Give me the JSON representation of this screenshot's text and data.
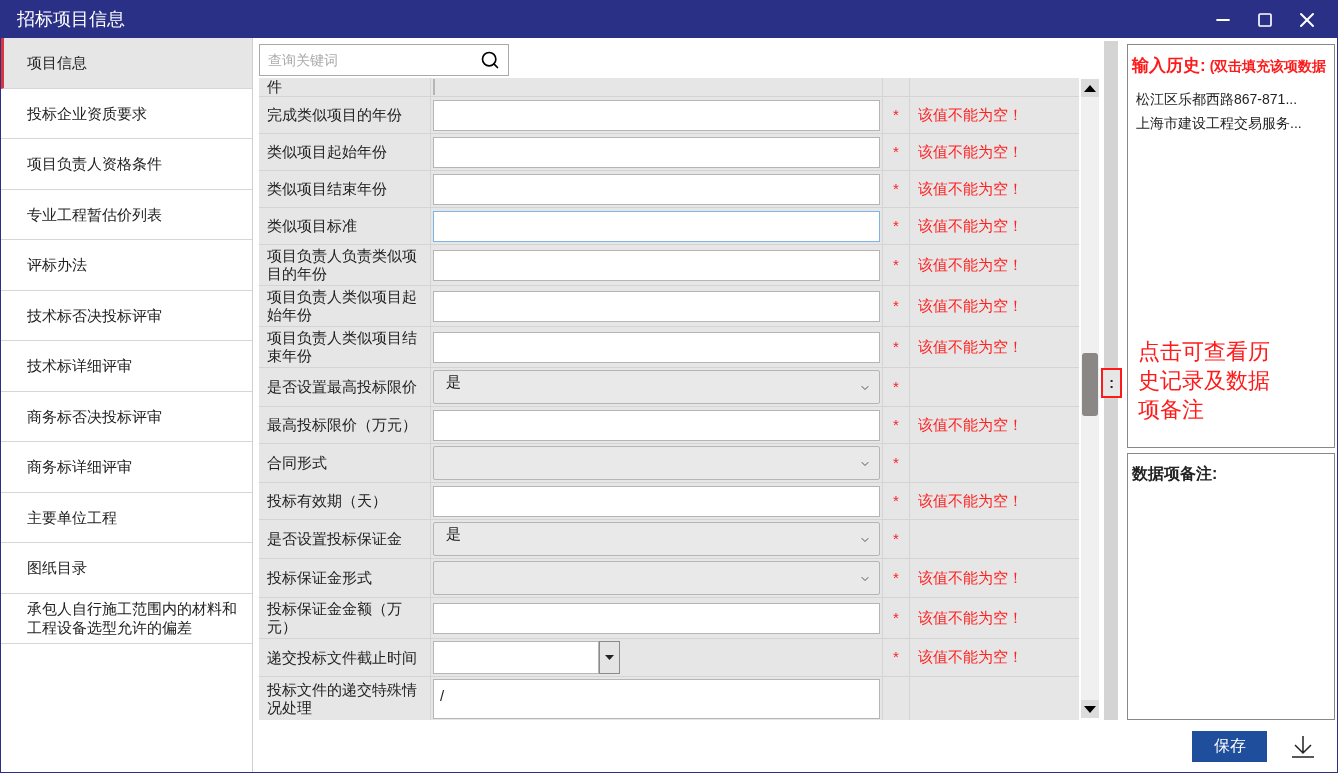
{
  "window": {
    "title": "招标项目信息"
  },
  "sidebar": {
    "items": [
      {
        "label": "项目信息",
        "selected": true
      },
      {
        "label": "投标企业资质要求",
        "selected": false
      },
      {
        "label": "项目负责人资格条件",
        "selected": false
      },
      {
        "label": "专业工程暂估价列表",
        "selected": false
      },
      {
        "label": "评标办法",
        "selected": false
      },
      {
        "label": "技术标否决投标评审",
        "selected": false
      },
      {
        "label": "技术标详细评审",
        "selected": false
      },
      {
        "label": "商务标否决投标评审",
        "selected": false
      },
      {
        "label": "商务标详细评审",
        "selected": false
      },
      {
        "label": "主要单位工程",
        "selected": false
      },
      {
        "label": "图纸目录",
        "selected": false
      },
      {
        "label": "承包人自行施工范围内的材料和工程设备选型允许的偏差",
        "selected": false
      }
    ]
  },
  "search": {
    "placeholder": "查询关键词"
  },
  "form": {
    "rows": [
      {
        "label": "件",
        "kind": "partial"
      },
      {
        "label": "完成类似项目的年份",
        "kind": "text",
        "error": "该值不能为空！",
        "star": "*"
      },
      {
        "label": "类似项目起始年份",
        "kind": "text",
        "error": "该值不能为空！",
        "star": "*"
      },
      {
        "label": "类似项目结束年份",
        "kind": "text",
        "error": "该值不能为空！",
        "star": "*"
      },
      {
        "label": "类似项目标准",
        "kind": "text",
        "focused": true,
        "error": "该值不能为空！",
        "star": "*"
      },
      {
        "label": "项目负责人负责类似项目的年份",
        "kind": "text",
        "error": "该值不能为空！",
        "star": "*"
      },
      {
        "label": "项目负责人类似项目起始年份",
        "kind": "text",
        "error": "该值不能为空！",
        "star": "*"
      },
      {
        "label": "项目负责人类似项目结束年份",
        "kind": "text",
        "error": "该值不能为空！",
        "star": "*"
      },
      {
        "label": "是否设置最高投标限价",
        "kind": "select",
        "value": "是",
        "star": "*"
      },
      {
        "label": "最高投标限价（万元）",
        "kind": "text",
        "error": "该值不能为空！",
        "star": "*"
      },
      {
        "label": "合同形式",
        "kind": "select",
        "star": "*"
      },
      {
        "label": "投标有效期（天）",
        "kind": "text",
        "error": "该值不能为空！",
        "star": "*"
      },
      {
        "label": "是否设置投标保证金",
        "kind": "select",
        "value": "是",
        "star": "*"
      },
      {
        "label": "投标保证金形式",
        "kind": "select",
        "error": "该值不能为空！",
        "star": "*"
      },
      {
        "label": "投标保证金金额（万元）",
        "kind": "text",
        "error": "该值不能为空！",
        "star": "*"
      },
      {
        "label": "递交投标文件截止时间",
        "kind": "date",
        "error": "该值不能为空！",
        "star": "*"
      },
      {
        "label": "投标文件的递交特殊情况处理",
        "kind": "textarea",
        "value": "/"
      }
    ]
  },
  "splitter": {
    "handle": ":",
    "hint": "点击可查看历史记录及数据项备注"
  },
  "history": {
    "title": "输入历史:",
    "subtitle": "(双击填充该项数据",
    "items": [
      "松江区乐都西路867-871...",
      "上海市建设工程交易服务..."
    ]
  },
  "notes": {
    "title": "数据项备注:"
  },
  "buttons": {
    "save": "保存"
  }
}
